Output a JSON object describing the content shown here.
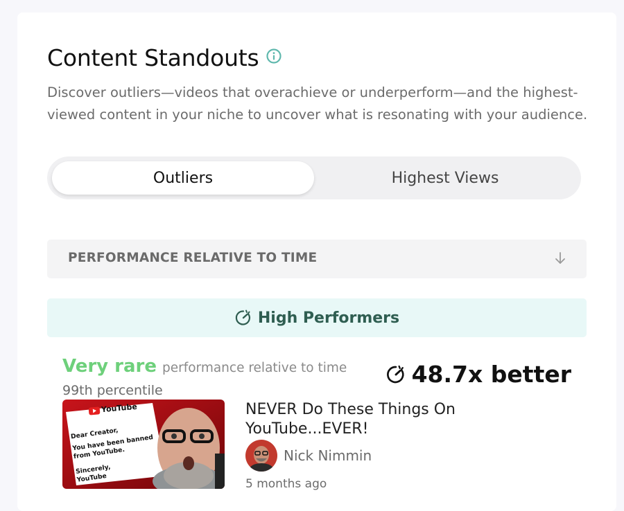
{
  "section": {
    "title": "Content Standouts",
    "description": "Discover outliers—videos that overachieve or underperform—and the highest-viewed content in your niche to uncover what is resonating with your audience."
  },
  "tabs": [
    {
      "label": "Outliers",
      "active": true
    },
    {
      "label": "Highest Views",
      "active": false
    }
  ],
  "sort": {
    "label": "PERFORMANCE RELATIVE TO TIME",
    "icon": "arrow-down-icon"
  },
  "group": {
    "label": "High Performers",
    "icon": "gauge-icon"
  },
  "video": {
    "rarity": "Very rare",
    "rarity_desc": "performance relative to time",
    "percentile": "99th percentile",
    "multiplier": "48.7x better",
    "title": "NEVER Do These Things On YouTube...EVER!",
    "channel": "Nick Nimmin",
    "age": "5 months ago",
    "thumbnail": {
      "brand": "YouTube",
      "letter_lines": [
        "Dear Creator,",
        "You have been banned",
        "from YouTube.",
        "Sincerely,",
        "YouTube"
      ]
    }
  },
  "colors": {
    "accent_teal": "#5fb8ad",
    "rare_green": "#6ed07b",
    "banner_bg": "#e8f8f7",
    "banner_text": "#2f5e51"
  }
}
